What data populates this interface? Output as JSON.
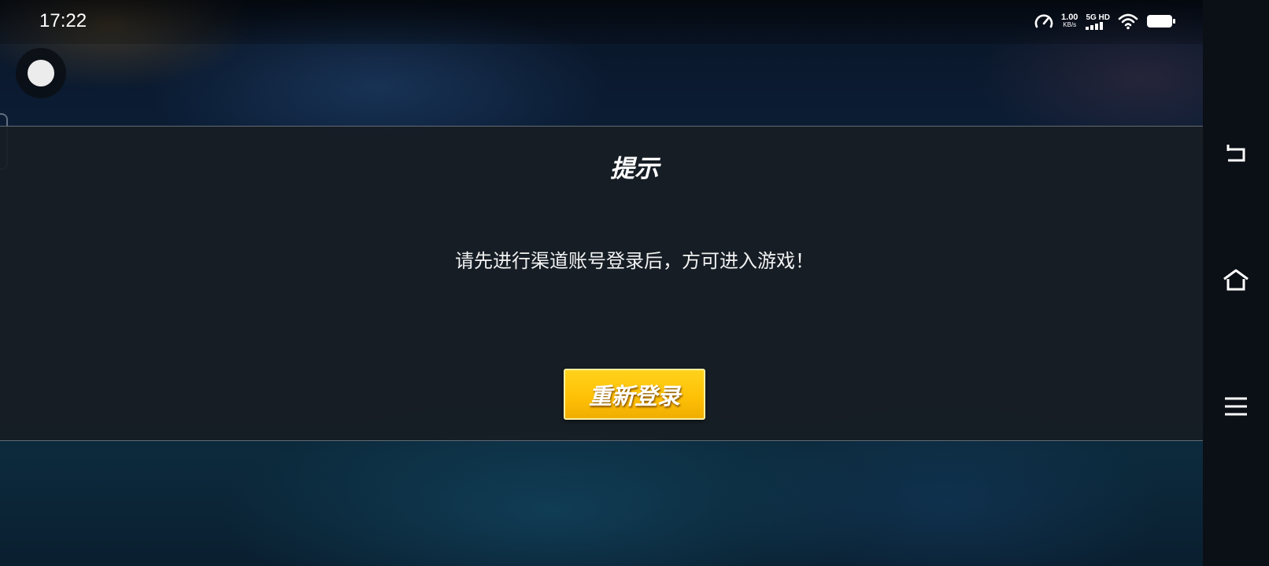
{
  "status_bar": {
    "time": "17:22",
    "net_speed_value": "1.00",
    "net_speed_unit": "KB/s",
    "network_type": "5G HD",
    "icons": [
      "speedometer-icon",
      "signal-bars-icon",
      "wifi-icon",
      "battery-icon"
    ]
  },
  "dialog": {
    "title": "提示",
    "message": "请先进行渠道账号登录后，方可进入游戏！",
    "button_label": "重新登录"
  },
  "nav_bar": {
    "icons": [
      "back-icon",
      "home-icon",
      "menu-icon"
    ]
  },
  "colors": {
    "button_yellow": "#ffc107",
    "dialog_background": "#181d24",
    "text_white": "#ffffff"
  }
}
